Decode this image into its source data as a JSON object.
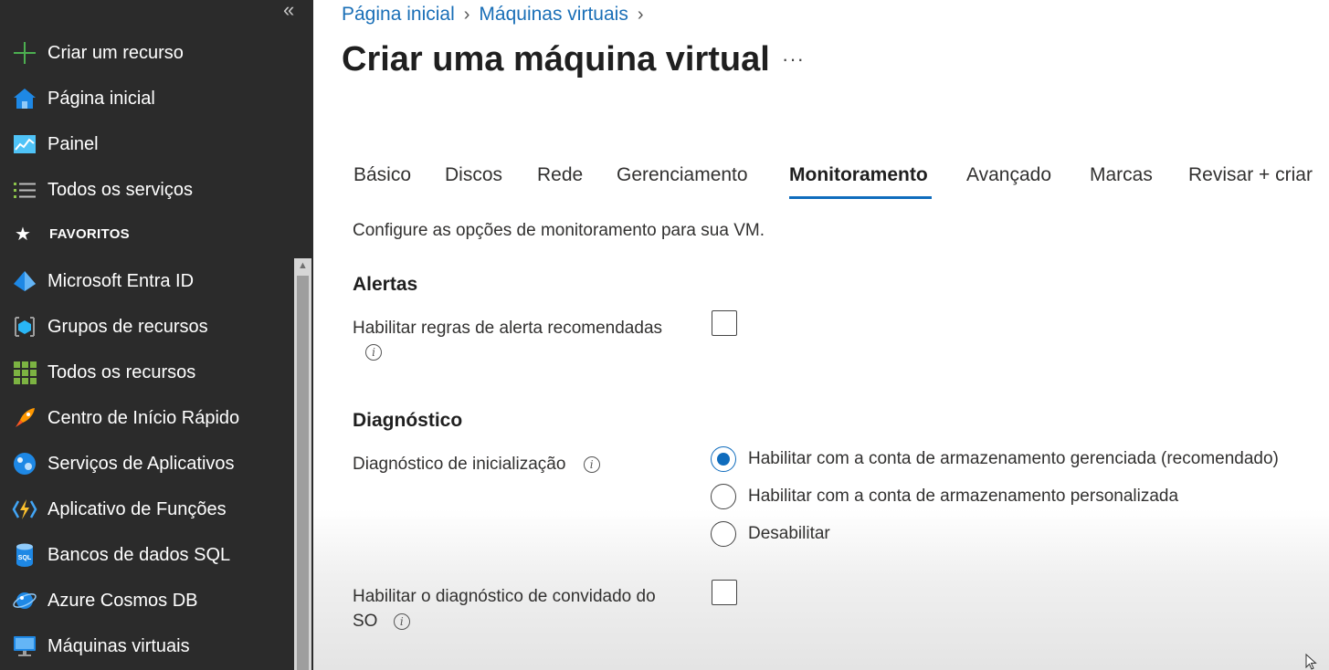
{
  "sidebar": {
    "collapse_label": "«",
    "items": [
      {
        "label": "Criar um recurso",
        "icon": "plus-icon"
      },
      {
        "label": "Página inicial",
        "icon": "home-icon"
      },
      {
        "label": "Painel",
        "icon": "dashboard-icon"
      },
      {
        "label": "Todos os serviços",
        "icon": "list-icon"
      }
    ],
    "favorites_header": "FAVORITOS",
    "favorites": [
      {
        "label": "Microsoft Entra ID",
        "icon": "entra-id-icon"
      },
      {
        "label": "Grupos de recursos",
        "icon": "resource-groups-icon"
      },
      {
        "label": "Todos os recursos",
        "icon": "all-resources-icon"
      },
      {
        "label": "Centro de Início Rápido",
        "icon": "rocket-icon"
      },
      {
        "label": "Serviços de Aplicativos",
        "icon": "app-services-icon"
      },
      {
        "label": "Aplicativo de Funções",
        "icon": "function-app-icon"
      },
      {
        "label": "Bancos de dados SQL",
        "icon": "sql-database-icon"
      },
      {
        "label": "Azure Cosmos DB",
        "icon": "cosmos-db-icon"
      },
      {
        "label": "Máquinas virtuais",
        "icon": "virtual-machine-icon"
      }
    ]
  },
  "breadcrumb": [
    "Página inicial",
    "Máquinas virtuais"
  ],
  "page": {
    "title": "Criar uma máquina virtual",
    "more_label": "···"
  },
  "tabs": [
    {
      "label": "Básico",
      "active": false
    },
    {
      "label": "Discos",
      "active": false
    },
    {
      "label": "Rede",
      "active": false
    },
    {
      "label": "Gerenciamento",
      "active": false
    },
    {
      "label": "Monitoramento",
      "active": true
    },
    {
      "label": "Avançado",
      "active": false
    },
    {
      "label": "Marcas",
      "active": false
    },
    {
      "label": "Revisar + criar",
      "active": false
    }
  ],
  "content": {
    "intro": "Configure as opções de monitoramento para sua VM.",
    "alerts": {
      "title": "Alertas",
      "enable_rules_label": "Habilitar regras de alerta recomendadas",
      "enable_rules_checked": false
    },
    "diagnostics": {
      "title": "Diagnóstico",
      "boot_label": "Diagnóstico de inicialização",
      "boot_options": [
        {
          "label": "Habilitar com a conta de armazenamento gerenciada (recomendado)",
          "selected": true
        },
        {
          "label": "Habilitar com a conta de armazenamento personalizada",
          "selected": false
        },
        {
          "label": "Desabilitar",
          "selected": false
        }
      ],
      "guest_label_line1": "Habilitar o diagnóstico de convidado do",
      "guest_label_line2": "SO",
      "guest_checked": false
    }
  },
  "colors": {
    "sidebar_bg": "#2b2b2b",
    "accent": "#0f6cbd",
    "link": "#1a6fb7"
  }
}
